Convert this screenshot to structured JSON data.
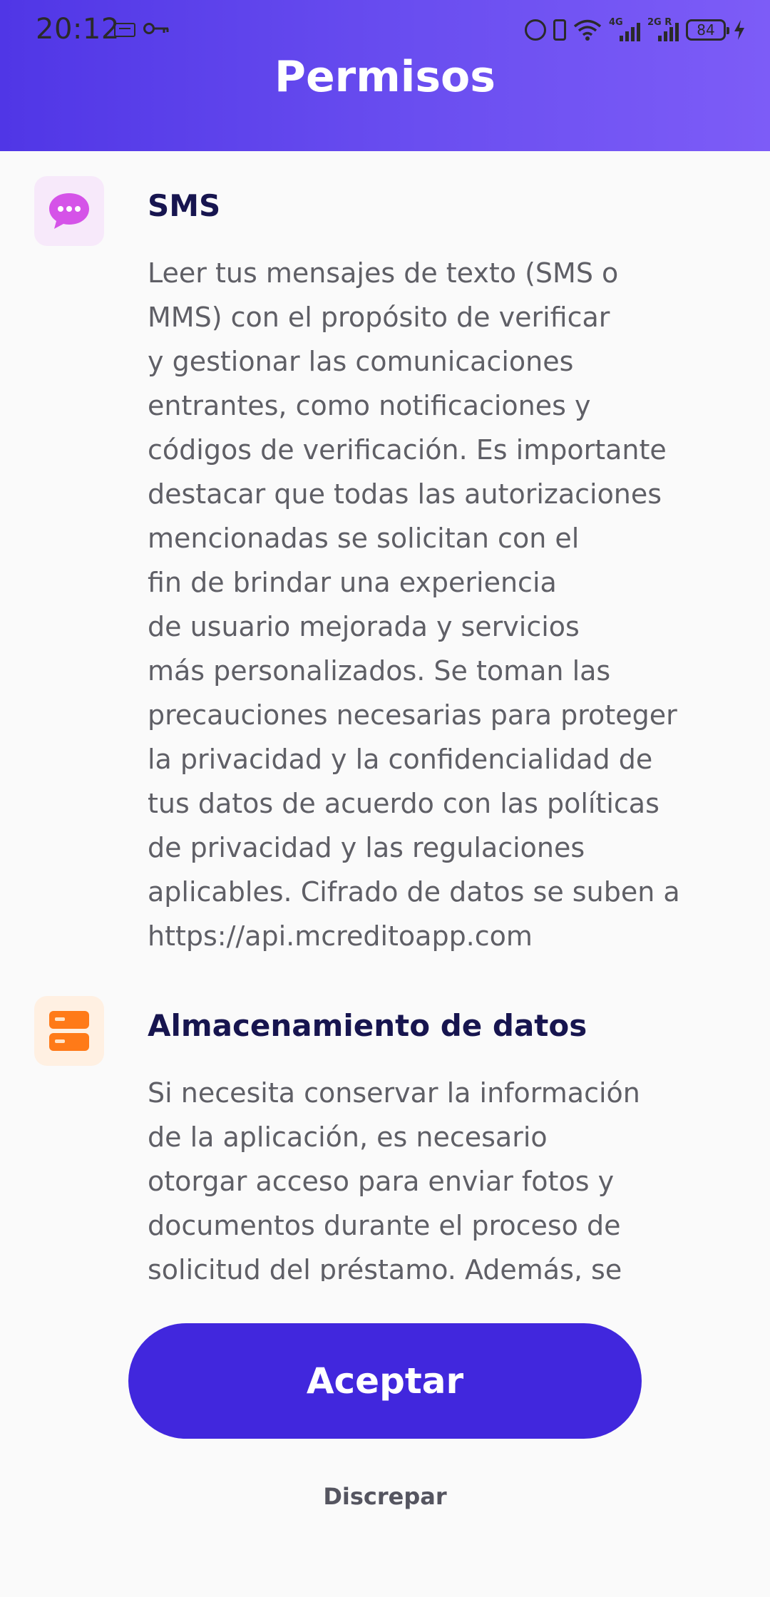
{
  "status_bar": {
    "time": "20:12",
    "network_1": "4G",
    "network_2": "2G R",
    "battery": "84",
    "icons": [
      "sim-icon",
      "key-icon",
      "alarm-icon",
      "vibrate-icon",
      "wifi-icon",
      "signal-icon",
      "signal-icon",
      "battery-icon",
      "charging-bolt-icon"
    ]
  },
  "header": {
    "title": "Permisos",
    "gradient": [
      "#5036e6",
      "#7d5cf7"
    ]
  },
  "permissions": [
    {
      "icon": "chat-bubble-icon",
      "icon_color": "#d553e8",
      "title": "SMS",
      "lines": [
        "Leer tus mensajes de texto (SMS o",
        "MMS) con el propósito de verificar",
        "y gestionar las comunicaciones",
        "entrantes, como notificaciones y",
        "códigos de verificación. Es importante",
        "destacar que todas las autorizaciones",
        "mencionadas se solicitan con el",
        "fin de brindar una experiencia",
        "de usuario mejorada y servicios",
        "más personalizados. Se toman las",
        "precauciones necesarias para proteger",
        "la privacidad y la confidencialidad de",
        "tus datos de acuerdo con las políticas",
        "de privacidad y las regulaciones",
        "aplicables. Cifrado de datos se suben a",
        "https://api.mcreditoapp.com"
      ]
    },
    {
      "icon": "storage-icon",
      "icon_color": "#ff7a18",
      "title": "Almacenamiento de datos",
      "lines": [
        "Si necesita conservar la información",
        "de la aplicación, es necesario",
        "otorgar acceso para enviar fotos y",
        "documentos durante el proceso de",
        "solicitud del préstamo. Además, se"
      ]
    }
  ],
  "buttons": {
    "accept": "Aceptar",
    "reject": "Discrepar",
    "accent": "#4127dd"
  }
}
